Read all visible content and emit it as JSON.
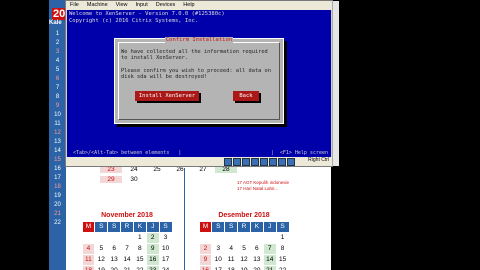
{
  "calendar": {
    "top_number": "20",
    "kal_text": "Kale",
    "left_digits": [
      "1",
      "2",
      "3",
      "4",
      "5",
      "6",
      "7",
      "8",
      "9",
      "10",
      "11",
      "12",
      "13",
      "14",
      "15",
      "16",
      "17",
      "18",
      "19",
      "20",
      "21",
      "22",
      "23",
      "24",
      "25",
      "26",
      "27"
    ],
    "partial_row": [
      "29",
      "30",
      "",
      "",
      "",
      "",
      ""
    ],
    "notes": [
      "17 AGT Kepulih indonesie",
      "17 Hari Natal Lahir..."
    ],
    "november": {
      "title": "November 2018",
      "headers": [
        "M",
        "S",
        "S",
        "R",
        "K",
        "J",
        "S"
      ],
      "rows": [
        [
          "",
          "",
          "",
          "",
          "1",
          "2",
          "3"
        ],
        [
          "4",
          "5",
          "6",
          "7",
          "8",
          "9",
          "10"
        ],
        [
          "11",
          "12",
          "13",
          "14",
          "15",
          "16",
          "17"
        ],
        [
          "18",
          "19",
          "20",
          "21",
          "22",
          "23",
          "24"
        ]
      ]
    },
    "desember": {
      "title": "Desember 2018",
      "headers": [
        "M",
        "S",
        "S",
        "R",
        "K",
        "J",
        "S"
      ],
      "rows": [
        [
          "",
          "",
          "",
          "",
          "",
          "",
          "1"
        ],
        [
          "2",
          "3",
          "4",
          "5",
          "6",
          "7",
          "8"
        ],
        [
          "9",
          "10",
          "11",
          "12",
          "13",
          "14",
          "15"
        ],
        [
          "16",
          "17",
          "18",
          "19",
          "20",
          "21",
          "22"
        ]
      ]
    },
    "first_month": {
      "rows": [
        [
          "23",
          "24",
          "25",
          "26",
          "27",
          "28"
        ],
        [
          "29",
          "30",
          "",
          "",
          "",
          ""
        ]
      ]
    }
  },
  "vm": {
    "menu": [
      "File",
      "Machine",
      "View",
      "Input",
      "Devices",
      "Help"
    ],
    "header_lines": [
      "Welcome to XenServer - Version 7.0.0 (#125380c)",
      "Copyright (c) 2016 Citrix Systems, Inc."
    ],
    "dialog": {
      "title": "Confirm Installation",
      "message": "We have collected all the information required\nto install XenServer.\n\nPlease confirm you wish to proceed: all data on\ndisk sda will be destroyed!",
      "install_button": "Install XenServer",
      "back_button": "Back"
    },
    "hint_left": "<Tab>/<Alt-Tab> between elements   |",
    "hint_right": "|  <F1> Help screen",
    "host_key": "Right Ctrl"
  }
}
